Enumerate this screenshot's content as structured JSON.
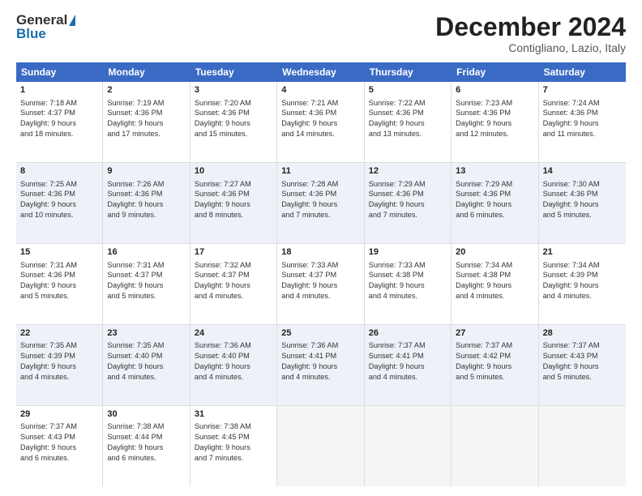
{
  "logo": {
    "general": "General",
    "blue": "Blue"
  },
  "header": {
    "month": "December 2024",
    "location": "Contigliano, Lazio, Italy"
  },
  "days": [
    "Sunday",
    "Monday",
    "Tuesday",
    "Wednesday",
    "Thursday",
    "Friday",
    "Saturday"
  ],
  "weeks": [
    [
      {
        "num": "1",
        "lines": [
          "Sunrise: 7:18 AM",
          "Sunset: 4:37 PM",
          "Daylight: 9 hours",
          "and 18 minutes."
        ]
      },
      {
        "num": "2",
        "lines": [
          "Sunrise: 7:19 AM",
          "Sunset: 4:36 PM",
          "Daylight: 9 hours",
          "and 17 minutes."
        ]
      },
      {
        "num": "3",
        "lines": [
          "Sunrise: 7:20 AM",
          "Sunset: 4:36 PM",
          "Daylight: 9 hours",
          "and 15 minutes."
        ]
      },
      {
        "num": "4",
        "lines": [
          "Sunrise: 7:21 AM",
          "Sunset: 4:36 PM",
          "Daylight: 9 hours",
          "and 14 minutes."
        ]
      },
      {
        "num": "5",
        "lines": [
          "Sunrise: 7:22 AM",
          "Sunset: 4:36 PM",
          "Daylight: 9 hours",
          "and 13 minutes."
        ]
      },
      {
        "num": "6",
        "lines": [
          "Sunrise: 7:23 AM",
          "Sunset: 4:36 PM",
          "Daylight: 9 hours",
          "and 12 minutes."
        ]
      },
      {
        "num": "7",
        "lines": [
          "Sunrise: 7:24 AM",
          "Sunset: 4:36 PM",
          "Daylight: 9 hours",
          "and 11 minutes."
        ]
      }
    ],
    [
      {
        "num": "8",
        "lines": [
          "Sunrise: 7:25 AM",
          "Sunset: 4:36 PM",
          "Daylight: 9 hours",
          "and 10 minutes."
        ]
      },
      {
        "num": "9",
        "lines": [
          "Sunrise: 7:26 AM",
          "Sunset: 4:36 PM",
          "Daylight: 9 hours",
          "and 9 minutes."
        ]
      },
      {
        "num": "10",
        "lines": [
          "Sunrise: 7:27 AM",
          "Sunset: 4:36 PM",
          "Daylight: 9 hours",
          "and 8 minutes."
        ]
      },
      {
        "num": "11",
        "lines": [
          "Sunrise: 7:28 AM",
          "Sunset: 4:36 PM",
          "Daylight: 9 hours",
          "and 7 minutes."
        ]
      },
      {
        "num": "12",
        "lines": [
          "Sunrise: 7:29 AM",
          "Sunset: 4:36 PM",
          "Daylight: 9 hours",
          "and 7 minutes."
        ]
      },
      {
        "num": "13",
        "lines": [
          "Sunrise: 7:29 AM",
          "Sunset: 4:36 PM",
          "Daylight: 9 hours",
          "and 6 minutes."
        ]
      },
      {
        "num": "14",
        "lines": [
          "Sunrise: 7:30 AM",
          "Sunset: 4:36 PM",
          "Daylight: 9 hours",
          "and 5 minutes."
        ]
      }
    ],
    [
      {
        "num": "15",
        "lines": [
          "Sunrise: 7:31 AM",
          "Sunset: 4:36 PM",
          "Daylight: 9 hours",
          "and 5 minutes."
        ]
      },
      {
        "num": "16",
        "lines": [
          "Sunrise: 7:31 AM",
          "Sunset: 4:37 PM",
          "Daylight: 9 hours",
          "and 5 minutes."
        ]
      },
      {
        "num": "17",
        "lines": [
          "Sunrise: 7:32 AM",
          "Sunset: 4:37 PM",
          "Daylight: 9 hours",
          "and 4 minutes."
        ]
      },
      {
        "num": "18",
        "lines": [
          "Sunrise: 7:33 AM",
          "Sunset: 4:37 PM",
          "Daylight: 9 hours",
          "and 4 minutes."
        ]
      },
      {
        "num": "19",
        "lines": [
          "Sunrise: 7:33 AM",
          "Sunset: 4:38 PM",
          "Daylight: 9 hours",
          "and 4 minutes."
        ]
      },
      {
        "num": "20",
        "lines": [
          "Sunrise: 7:34 AM",
          "Sunset: 4:38 PM",
          "Daylight: 9 hours",
          "and 4 minutes."
        ]
      },
      {
        "num": "21",
        "lines": [
          "Sunrise: 7:34 AM",
          "Sunset: 4:39 PM",
          "Daylight: 9 hours",
          "and 4 minutes."
        ]
      }
    ],
    [
      {
        "num": "22",
        "lines": [
          "Sunrise: 7:35 AM",
          "Sunset: 4:39 PM",
          "Daylight: 9 hours",
          "and 4 minutes."
        ]
      },
      {
        "num": "23",
        "lines": [
          "Sunrise: 7:35 AM",
          "Sunset: 4:40 PM",
          "Daylight: 9 hours",
          "and 4 minutes."
        ]
      },
      {
        "num": "24",
        "lines": [
          "Sunrise: 7:36 AM",
          "Sunset: 4:40 PM",
          "Daylight: 9 hours",
          "and 4 minutes."
        ]
      },
      {
        "num": "25",
        "lines": [
          "Sunrise: 7:36 AM",
          "Sunset: 4:41 PM",
          "Daylight: 9 hours",
          "and 4 minutes."
        ]
      },
      {
        "num": "26",
        "lines": [
          "Sunrise: 7:37 AM",
          "Sunset: 4:41 PM",
          "Daylight: 9 hours",
          "and 4 minutes."
        ]
      },
      {
        "num": "27",
        "lines": [
          "Sunrise: 7:37 AM",
          "Sunset: 4:42 PM",
          "Daylight: 9 hours",
          "and 5 minutes."
        ]
      },
      {
        "num": "28",
        "lines": [
          "Sunrise: 7:37 AM",
          "Sunset: 4:43 PM",
          "Daylight: 9 hours",
          "and 5 minutes."
        ]
      }
    ],
    [
      {
        "num": "29",
        "lines": [
          "Sunrise: 7:37 AM",
          "Sunset: 4:43 PM",
          "Daylight: 9 hours",
          "and 6 minutes."
        ]
      },
      {
        "num": "30",
        "lines": [
          "Sunrise: 7:38 AM",
          "Sunset: 4:44 PM",
          "Daylight: 9 hours",
          "and 6 minutes."
        ]
      },
      {
        "num": "31",
        "lines": [
          "Sunrise: 7:38 AM",
          "Sunset: 4:45 PM",
          "Daylight: 9 hours",
          "and 7 minutes."
        ]
      },
      null,
      null,
      null,
      null
    ]
  ]
}
